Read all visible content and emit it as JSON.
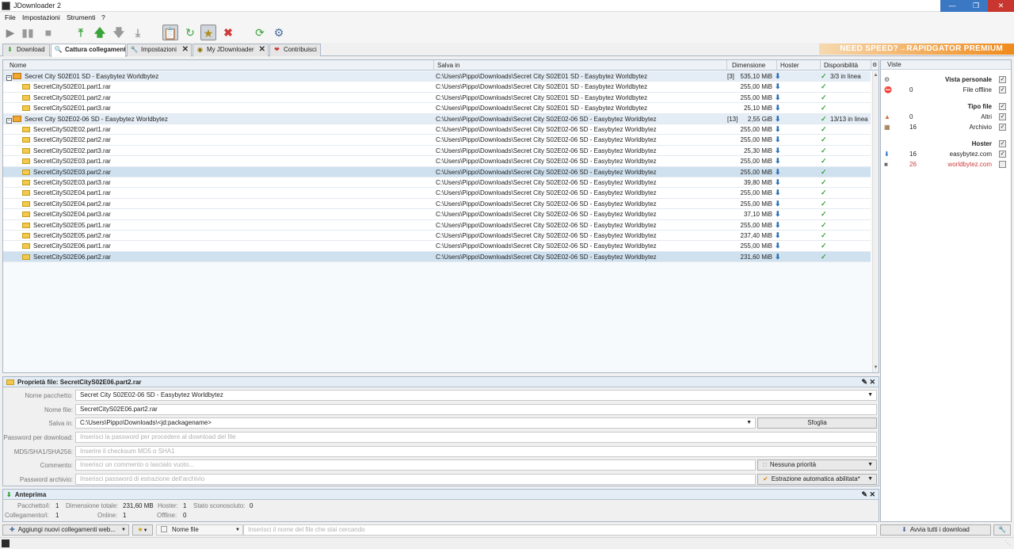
{
  "window": {
    "title": "JDownloader 2"
  },
  "menu": [
    "File",
    "Impostazioni",
    "Strumenti",
    "?"
  ],
  "toolbar": {
    "icons": [
      "play-icon",
      "pause-icon",
      "stop-icon",
      "move-top-icon",
      "move-up-icon",
      "move-down-icon",
      "move-bottom-icon",
      "clipboard-icon",
      "reconnect-icon",
      "premium-icon",
      "clear-icon",
      "update-icon",
      "settings-icon"
    ]
  },
  "tabs": [
    {
      "label": "Download",
      "closable": false
    },
    {
      "label": "Cattura collegamenti",
      "closable": false
    },
    {
      "label": "Impostazioni",
      "closable": true
    },
    {
      "label": "My JDownloader",
      "closable": true
    },
    {
      "label": "Contribuisci",
      "closable": false
    }
  ],
  "promo": "NEED SPEED?→RAPIDGATOR PREMIUM",
  "table": {
    "headers": [
      "Nome",
      "Salva in",
      "Dimensione",
      "Hoster",
      "Disponibilità"
    ],
    "rows": [
      {
        "type": "pkg",
        "name": "Secret City S02E01 SD - Easybytez Worldbytez",
        "path": "C:\\Users\\Pippo\\Downloads\\Secret City S02E01 SD - Easybytez Worldbytez",
        "count": "[3]",
        "size": "535,10 MiB",
        "avail": "3/3 in linea"
      },
      {
        "type": "file",
        "name": "SecretCityS02E01.part1.rar",
        "path": "C:\\Users\\Pippo\\Downloads\\Secret City S02E01 SD - Easybytez Worldbytez",
        "size": "255,00 MiB"
      },
      {
        "type": "file",
        "name": "SecretCityS02E01.part2.rar",
        "path": "C:\\Users\\Pippo\\Downloads\\Secret City S02E01 SD - Easybytez Worldbytez",
        "size": "255,00 MiB"
      },
      {
        "type": "file",
        "name": "SecretCityS02E01.part3.rar",
        "path": "C:\\Users\\Pippo\\Downloads\\Secret City S02E01 SD - Easybytez Worldbytez",
        "size": "25,10 MiB"
      },
      {
        "type": "pkg",
        "name": "Secret City S02E02-06 SD - Easybytez Worldbytez",
        "path": "C:\\Users\\Pippo\\Downloads\\Secret City S02E02-06 SD - Easybytez Worldbytez",
        "count": "[13]",
        "size": "2,55 GiB",
        "avail": "13/13 in linea"
      },
      {
        "type": "file",
        "name": "SecretCityS02E02.part1.rar",
        "path": "C:\\Users\\Pippo\\Downloads\\Secret City S02E02-06 SD - Easybytez Worldbytez",
        "size": "255,00 MiB"
      },
      {
        "type": "file",
        "name": "SecretCityS02E02.part2.rar",
        "path": "C:\\Users\\Pippo\\Downloads\\Secret City S02E02-06 SD - Easybytez Worldbytez",
        "size": "255,00 MiB"
      },
      {
        "type": "file",
        "name": "SecretCityS02E02.part3.rar",
        "path": "C:\\Users\\Pippo\\Downloads\\Secret City S02E02-06 SD - Easybytez Worldbytez",
        "size": "25,30 MiB"
      },
      {
        "type": "file",
        "name": "SecretCityS02E03.part1.rar",
        "path": "C:\\Users\\Pippo\\Downloads\\Secret City S02E02-06 SD - Easybytez Worldbytez",
        "size": "255,00 MiB"
      },
      {
        "type": "file",
        "name": "SecretCityS02E03.part2.rar",
        "path": "C:\\Users\\Pippo\\Downloads\\Secret City S02E02-06 SD - Easybytez Worldbytez",
        "size": "255,00 MiB",
        "selected": true
      },
      {
        "type": "file",
        "name": "SecretCityS02E03.part3.rar",
        "path": "C:\\Users\\Pippo\\Downloads\\Secret City S02E02-06 SD - Easybytez Worldbytez",
        "size": "39,80 MiB"
      },
      {
        "type": "file",
        "name": "SecretCityS02E04.part1.rar",
        "path": "C:\\Users\\Pippo\\Downloads\\Secret City S02E02-06 SD - Easybytez Worldbytez",
        "size": "255,00 MiB"
      },
      {
        "type": "file",
        "name": "SecretCityS02E04.part2.rar",
        "path": "C:\\Users\\Pippo\\Downloads\\Secret City S02E02-06 SD - Easybytez Worldbytez",
        "size": "255,00 MiB"
      },
      {
        "type": "file",
        "name": "SecretCityS02E04.part3.rar",
        "path": "C:\\Users\\Pippo\\Downloads\\Secret City S02E02-06 SD - Easybytez Worldbytez",
        "size": "37,10 MiB"
      },
      {
        "type": "file",
        "name": "SecretCityS02E05.part1.rar",
        "path": "C:\\Users\\Pippo\\Downloads\\Secret City S02E02-06 SD - Easybytez Worldbytez",
        "size": "255,00 MiB"
      },
      {
        "type": "file",
        "name": "SecretCityS02E05.part2.rar",
        "path": "C:\\Users\\Pippo\\Downloads\\Secret City S02E02-06 SD - Easybytez Worldbytez",
        "size": "237,40 MiB"
      },
      {
        "type": "file",
        "name": "SecretCityS02E06.part1.rar",
        "path": "C:\\Users\\Pippo\\Downloads\\Secret City S02E02-06 SD - Easybytez Worldbytez",
        "size": "255,00 MiB"
      },
      {
        "type": "file",
        "name": "SecretCityS02E06.part2.rar",
        "path": "C:\\Users\\Pippo\\Downloads\\Secret City S02E02-06 SD - Easybytez Worldbytez",
        "size": "231,60 MiB",
        "selected": true
      }
    ]
  },
  "views": {
    "title": "Viste",
    "items": [
      {
        "kind": "header",
        "label": "Vista personale",
        "checked": true
      },
      {
        "kind": "item",
        "icon": "offline-icon",
        "count": "0",
        "label": "File offline",
        "checked": true
      },
      {
        "kind": "header",
        "label": "Tipo file",
        "checked": true
      },
      {
        "kind": "item",
        "icon": "other-file-icon",
        "count": "0",
        "label": "Altri",
        "checked": true
      },
      {
        "kind": "item",
        "icon": "archive-icon",
        "count": "16",
        "label": "Archivio",
        "checked": true
      },
      {
        "kind": "header",
        "label": "Hoster",
        "checked": true
      },
      {
        "kind": "item",
        "icon": "easybytez-icon",
        "count": "16",
        "label": "easybytez.com",
        "checked": true
      },
      {
        "kind": "item",
        "icon": "worldbytez-icon",
        "count": "26",
        "label": "worldbytez.com",
        "checked": false,
        "color": "#d03a3a"
      }
    ]
  },
  "properties": {
    "title": "Proprietà file: SecretCityS02E06.part2.rar",
    "package_label": "Nome pacchetto:",
    "package_value": "Secret City S02E02-06 SD - Easybytez Worldbytez",
    "filename_label": "Nome file:",
    "filename_value": "SecretCityS02E06.part2.rar",
    "saveto_label": "Salva in:",
    "saveto_value": "C:\\Users\\Pippo\\Downloads\\<jd:packagename>",
    "browse": "Sfoglia",
    "password_label": "Password per download:",
    "password_placeholder": "Inserisci la password per procedere al download del file",
    "checksum_label": "MD5/SHA1/SHA256:",
    "checksum_placeholder": "Inserire il checksum MD5 o SHA1",
    "comment_label": "Commento:",
    "comment_placeholder": "Inserisci un commento o lascialo vuoto...",
    "priority": "Nessuna priorità",
    "archivepw_label": "Password archivio:",
    "archivepw_placeholder": "Inserisci password di estrazione dell'archivio",
    "extract": "Estrazione automatica abilitata*"
  },
  "preview": {
    "title": "Anteprima",
    "stats": [
      {
        "label": "Pacchetto/i:",
        "value": "1"
      },
      {
        "label": "Dimensione totale:",
        "value": "231,60 MB"
      },
      {
        "label": "Hoster:",
        "value": "1"
      },
      {
        "label": "Stato sconosciuto:",
        "value": "0"
      },
      {
        "label": "Collegamento/i:",
        "value": "1"
      },
      {
        "label": "Online:",
        "value": "1"
      },
      {
        "label": "Offline:",
        "value": "0"
      }
    ]
  },
  "bottom": {
    "add_links": "Aggiungi nuovi collegamenti web...",
    "filter_column": "Nome file",
    "search_placeholder": "Inserisci il nome del file che stai cercando",
    "start_all": "Avvia tutti i download"
  }
}
